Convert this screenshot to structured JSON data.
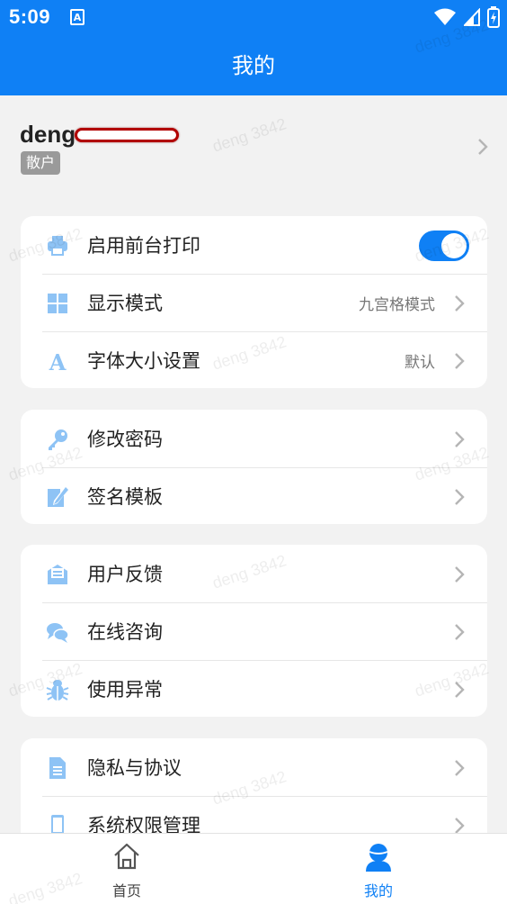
{
  "status_bar": {
    "time": "5:09",
    "notification_letter": "A"
  },
  "header": {
    "title": "我的"
  },
  "profile": {
    "username": "deng",
    "badge": "散户"
  },
  "settings_card": {
    "items": [
      {
        "label": "启用前台打印",
        "icon": "printer-icon",
        "toggle_on": true
      },
      {
        "label": "显示模式",
        "icon": "grid-icon",
        "value": "九宫格模式"
      },
      {
        "label": "字体大小设置",
        "icon": "font-icon",
        "value": "默认"
      }
    ]
  },
  "account_card": {
    "items": [
      {
        "label": "修改密码",
        "icon": "key-icon"
      },
      {
        "label": "签名模板",
        "icon": "signature-icon"
      }
    ]
  },
  "support_card": {
    "items": [
      {
        "label": "用户反馈",
        "icon": "feedback-icon"
      },
      {
        "label": "在线咨询",
        "icon": "chat-icon"
      },
      {
        "label": "使用异常",
        "icon": "bug-icon"
      }
    ]
  },
  "legal_card": {
    "items": [
      {
        "label": "隐私与协议",
        "icon": "document-icon"
      },
      {
        "label": "系统权限管理",
        "icon": "phone-icon"
      }
    ]
  },
  "tabbar": {
    "tabs": [
      {
        "label": "首页",
        "icon": "home-icon",
        "active": false
      },
      {
        "label": "我的",
        "icon": "user-icon",
        "active": true
      }
    ]
  },
  "watermark": "deng 3842",
  "colors": {
    "primary": "#0f80f5",
    "icon_light": "#8ec3f5",
    "background": "#f2f2f2"
  }
}
